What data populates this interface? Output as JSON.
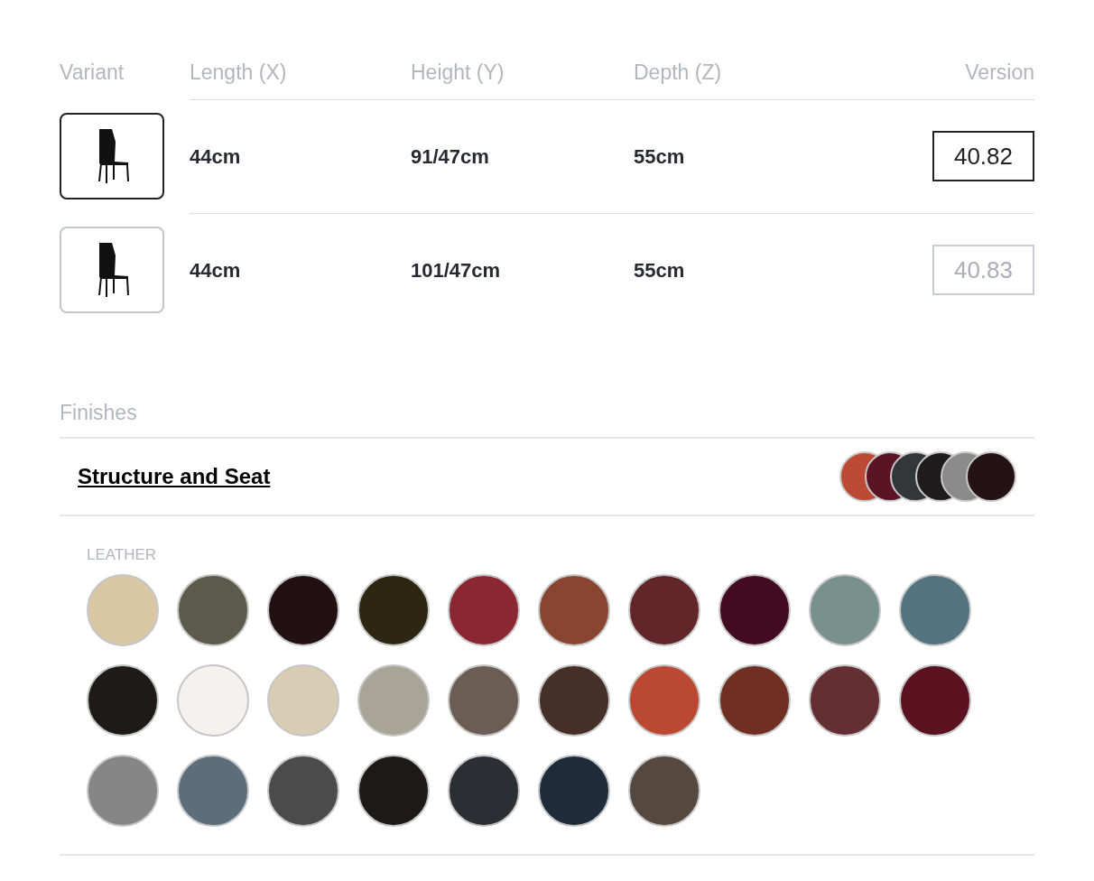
{
  "columns": [
    "Variant",
    "Length (X)",
    "Height (Y)",
    "Depth (Z)",
    "Version"
  ],
  "variants": [
    {
      "selected": true,
      "length": "44cm",
      "height": "91/47cm",
      "depth": "55cm",
      "version": "40.82"
    },
    {
      "selected": false,
      "length": "44cm",
      "height": "101/47cm",
      "depth": "55cm",
      "version": "40.83"
    }
  ],
  "finishes": {
    "title": "Finishes",
    "group": "Structure and Seat",
    "preview": [
      {
        "color": "#bc4a34"
      },
      {
        "color": "#5a1424"
      },
      {
        "color": "#33373a"
      },
      {
        "color": "#1e1c1c"
      },
      {
        "color": "#8a8b8a"
      },
      {
        "color": "#241216"
      }
    ],
    "category": "LEATHER",
    "swatches": [
      {
        "color": "#d9c6a5"
      },
      {
        "color": "#5c5a4b"
      },
      {
        "color": "#231012"
      },
      {
        "color": "#2c2613"
      },
      {
        "color": "#8b2733"
      },
      {
        "color": "#8a4532"
      },
      {
        "color": "#622528"
      },
      {
        "color": "#430b22"
      },
      {
        "color": "#78918a"
      },
      {
        "color": "#52737f"
      },
      {
        "color": "#1d1a19"
      },
      {
        "color": "#f3f2ee"
      },
      {
        "color": "#d8ccb4"
      },
      {
        "color": "#a9a596"
      },
      {
        "color": "#6b5d54"
      },
      {
        "color": "#452f26"
      },
      {
        "color": "#ba4833"
      },
      {
        "color": "#6f2f22"
      },
      {
        "color": "#642e33"
      },
      {
        "color": "#5a1221"
      },
      {
        "color": "#858685"
      },
      {
        "color": "#5b6e7a"
      },
      {
        "color": "#4b4b4b"
      },
      {
        "color": "#1d1918"
      },
      {
        "color": "#2b2f33"
      },
      {
        "color": "#1e2b3a"
      },
      {
        "color": "#54483f"
      }
    ]
  }
}
